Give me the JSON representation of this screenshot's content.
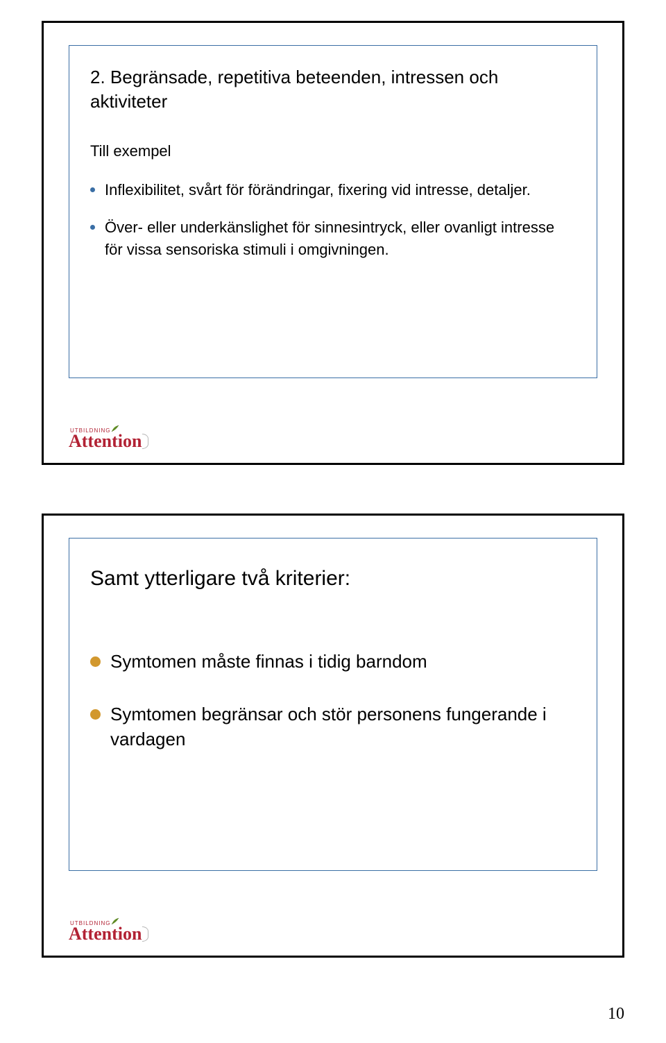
{
  "slide1": {
    "heading": "2. Begränsade, repetitiva beteenden, intressen och aktiviteter",
    "intro": "Till exempel",
    "bullets": [
      "Inflexibilitet, svårt för förändringar, fixering vid intresse, detaljer.",
      "Över- eller underkänslighet för sinnesintryck, eller ovanligt intresse för vissa sensoriska stimuli i omgivningen."
    ]
  },
  "slide2": {
    "heading": "Samt ytterligare två kriterier:",
    "bullets": [
      "Symtomen måste finnas i tidig barndom",
      "Symtomen begränsar och stör personens fungerande i vardagen"
    ]
  },
  "logo": {
    "top": "UTBILDNING",
    "main": "Attention"
  },
  "page_number": "10"
}
